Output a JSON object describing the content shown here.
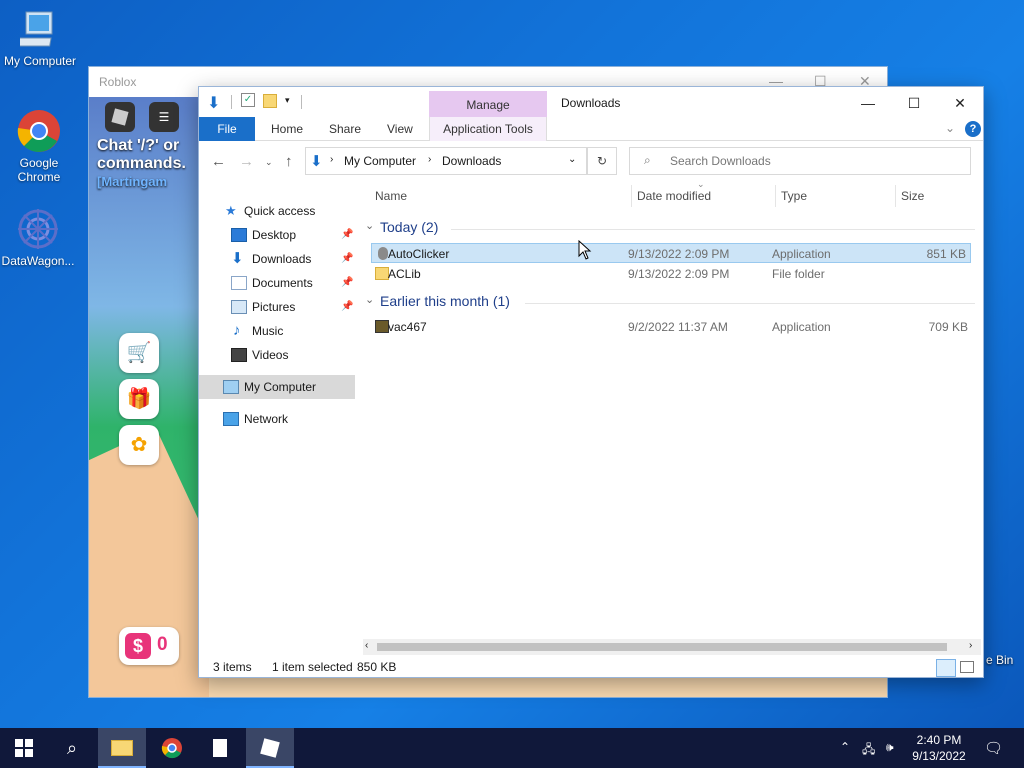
{
  "desktop": {
    "icons": [
      {
        "label": "My Computer"
      },
      {
        "label": "Google Chrome"
      },
      {
        "label": "DataWagon..."
      }
    ],
    "recycle_partial": "e Bin"
  },
  "roblox_window": {
    "title": "Roblox",
    "chat_text": "Chat '/?' or commands.",
    "player_text": "[Martingam",
    "currency": "0"
  },
  "explorer": {
    "title": "Downloads",
    "manage_tab": "Manage",
    "ribbon_tabs": [
      "File",
      "Home",
      "Share",
      "View",
      "Application Tools"
    ],
    "path": [
      "My Computer",
      "Downloads"
    ],
    "search_placeholder": "Search Downloads",
    "nav": {
      "quick_access": "Quick access",
      "items": [
        "Desktop",
        "Downloads",
        "Documents",
        "Pictures",
        "Music",
        "Videos"
      ],
      "my_computer": "My Computer",
      "network": "Network"
    },
    "columns": [
      "Name",
      "Date modified",
      "Type",
      "Size"
    ],
    "groups": [
      {
        "label": "Today (2)",
        "rows": [
          {
            "name": "AutoClicker",
            "date": "9/13/2022 2:09 PM",
            "type": "Application",
            "size": "851 KB"
          },
          {
            "name": "ACLib",
            "date": "9/13/2022 2:09 PM",
            "type": "File folder",
            "size": ""
          }
        ]
      },
      {
        "label": "Earlier this month (1)",
        "rows": [
          {
            "name": "vac467",
            "date": "9/2/2022 11:37 AM",
            "type": "Application",
            "size": "709 KB"
          }
        ]
      }
    ],
    "status": {
      "items": "3 items",
      "selected": "1 item selected",
      "size": "850 KB"
    }
  },
  "taskbar": {
    "time": "2:40 PM",
    "date": "9/13/2022"
  }
}
